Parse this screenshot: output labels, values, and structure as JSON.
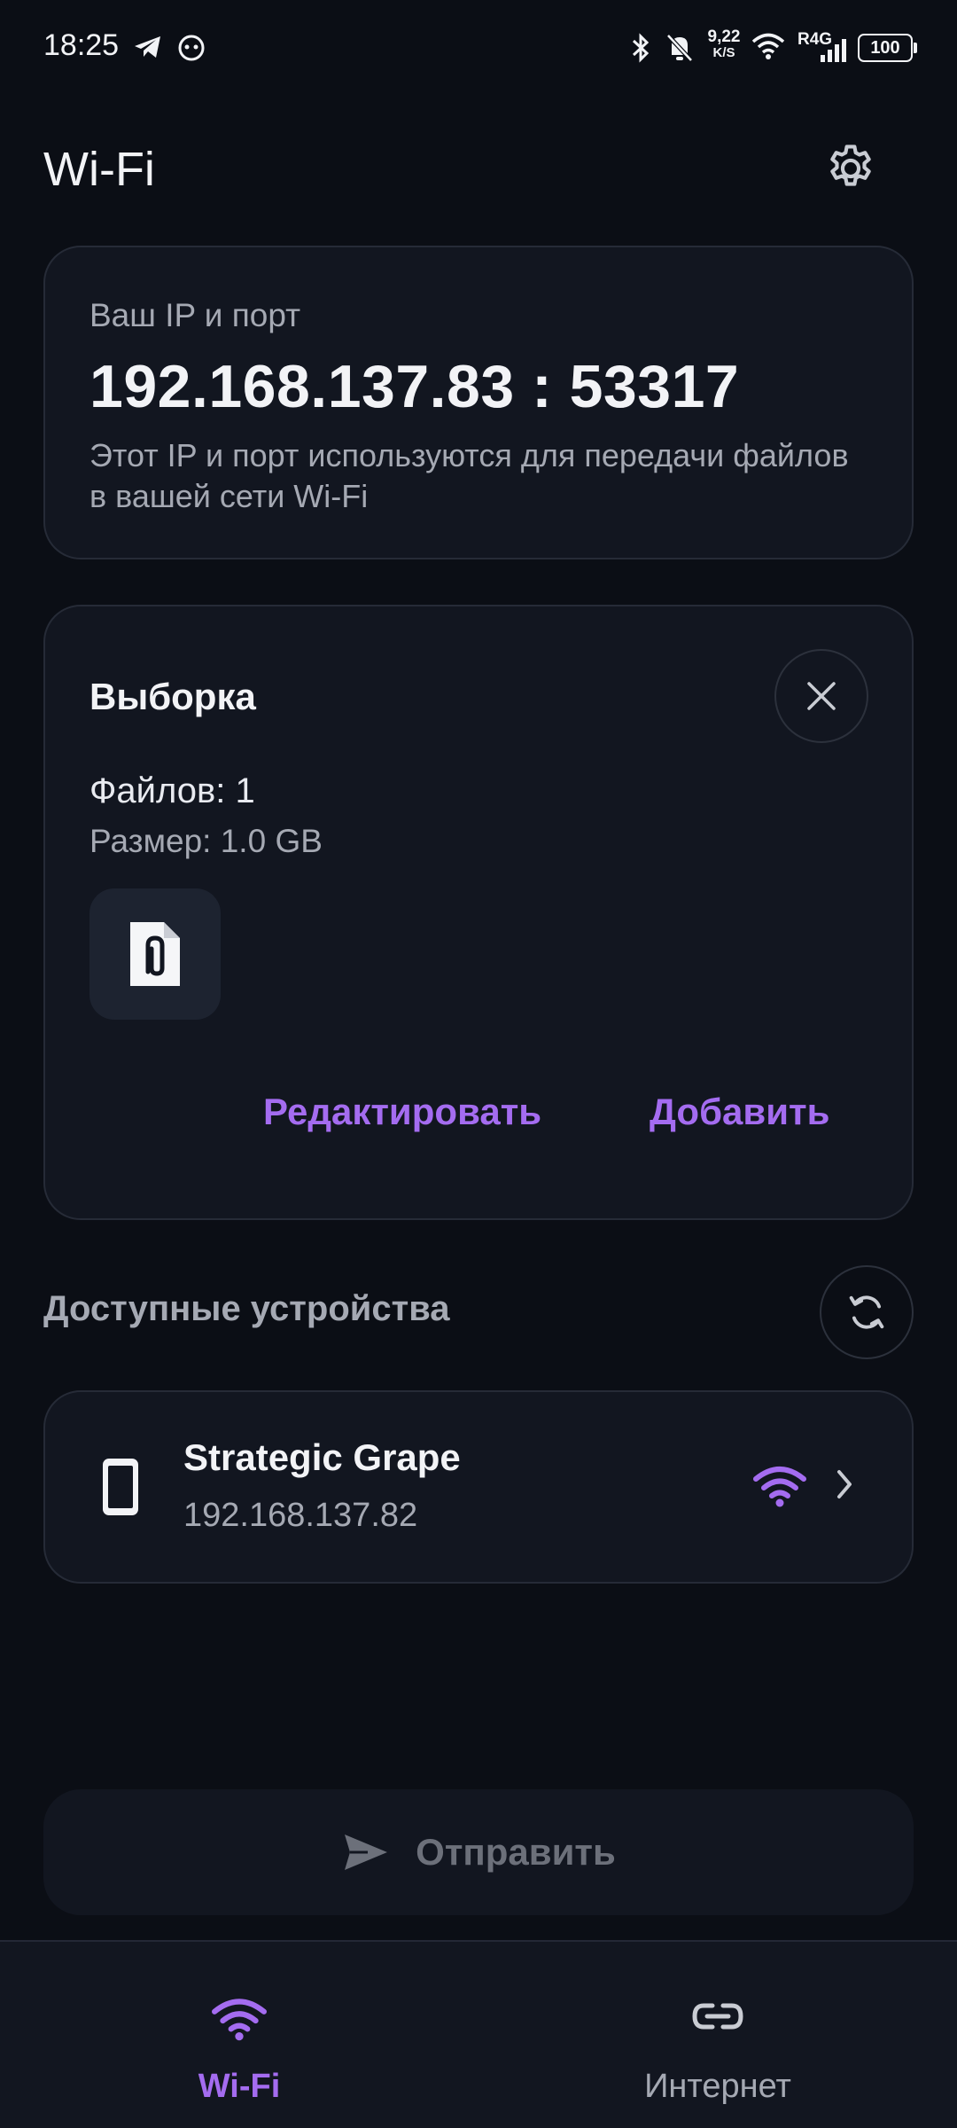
{
  "status_bar": {
    "time": "18:25",
    "speed_top": "9,22",
    "speed_bottom": "K/S",
    "network": "R4G",
    "battery": "100"
  },
  "header": {
    "title": "Wi-Fi"
  },
  "ip_card": {
    "label": "Ваш IP и порт",
    "value": "192.168.137.83 : 53317",
    "description": "Этот IP и порт используются для передачи файлов в вашей сети Wi-Fi"
  },
  "selection": {
    "title": "Выборка",
    "files": "Файлов: 1",
    "size": "Размер: 1.0 GB",
    "edit_label": "Редактировать",
    "add_label": "Добавить"
  },
  "devices": {
    "section_title": "Доступные устройства",
    "items": [
      {
        "name": "Strategic Grape",
        "ip": "192.168.137.82"
      }
    ]
  },
  "send": {
    "label": "Отправить"
  },
  "bottom_nav": {
    "items": [
      {
        "label": "Wi-Fi",
        "icon": "wifi-icon",
        "active": true
      },
      {
        "label": "Интернет",
        "icon": "link-icon",
        "active": false
      }
    ]
  },
  "colors": {
    "accent": "#a46cf0",
    "background": "#0b0e15",
    "card": "#121620"
  }
}
